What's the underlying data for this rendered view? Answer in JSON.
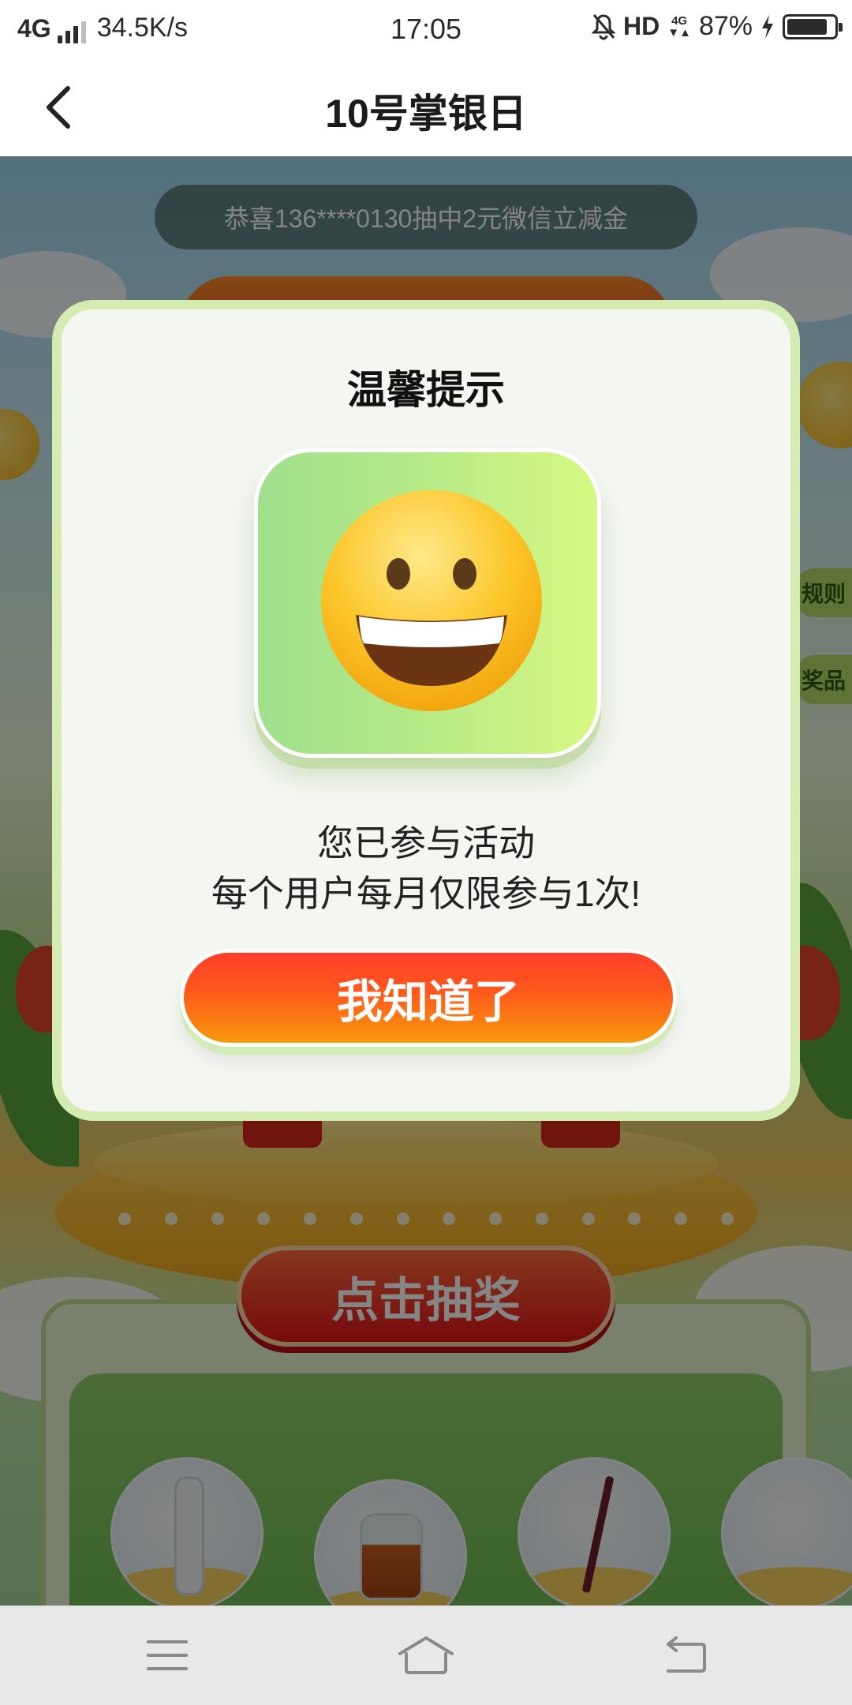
{
  "status_bar": {
    "network": "4G",
    "speed": "34.5K/s",
    "time": "17:05",
    "hd": "HD",
    "net_badge": "4G",
    "battery": "87%",
    "battery_level": 0.87
  },
  "header": {
    "title": "10号掌银日"
  },
  "background": {
    "ticker": "恭喜136****0130抽中2元微信立减金",
    "side_tab_rules": "规则",
    "side_tab_prizes": "奖品",
    "draw_button": "点击抽奖"
  },
  "dialog": {
    "title": "温馨提示",
    "icon": "grinning-face-icon",
    "message_line1": "您已参与活动",
    "message_line2": "每个用户每月仅限参与1次!",
    "confirm_button": "我知道了"
  },
  "navigation": {
    "menu_icon": "menu-icon",
    "home_icon": "home-icon",
    "back_icon": "back-icon"
  },
  "colors": {
    "dialog_border": "#d4ecb2",
    "button_top": "#ff3d2a",
    "button_bottom": "#f79a0a",
    "tile_left": "#9fe08c",
    "tile_right": "#d6f882"
  }
}
